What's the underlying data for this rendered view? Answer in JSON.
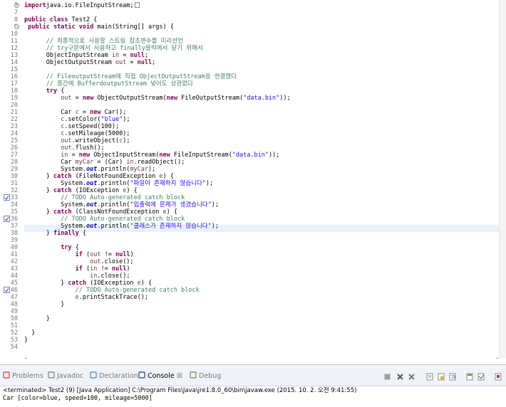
{
  "editor": {
    "lines": [
      {
        "num": "1",
        "segs": [
          [
            "kw",
            "import"
          ],
          [
            "",
            "java.io.FileInputStream;"
          ]
        ],
        "tail": "box"
      },
      {
        "num": "7",
        "segs": []
      },
      {
        "num": "8",
        "segs": [
          [
            "kw",
            "public class"
          ],
          [
            "",
            " Test2 {"
          ]
        ]
      },
      {
        "num": "9",
        "segs": [
          [
            "",
            " "
          ],
          [
            "kw",
            "public static void"
          ],
          [
            "",
            " main(String[] args) {"
          ]
        ]
      },
      {
        "num": "10",
        "segs": []
      },
      {
        "num": "11",
        "segs": [
          [
            "",
            "      "
          ],
          [
            "cm",
            "// 최종적으로 사용할 스트림 참조변수를 미리선언"
          ]
        ]
      },
      {
        "num": "12",
        "segs": [
          [
            "",
            "      "
          ],
          [
            "cm",
            "// try구문에서 사용하고 finally블럭에서 닫기 위해서"
          ]
        ]
      },
      {
        "num": "13",
        "segs": [
          [
            "",
            "      ObjectInputStream "
          ],
          [
            "vr",
            "in"
          ],
          [
            "",
            " = "
          ],
          [
            "kw",
            "null"
          ],
          [
            "",
            ";"
          ]
        ]
      },
      {
        "num": "14",
        "segs": [
          [
            "",
            "      ObjectOutputStream "
          ],
          [
            "vr",
            "out"
          ],
          [
            "",
            " = "
          ],
          [
            "kw",
            "null"
          ],
          [
            "",
            ";"
          ]
        ]
      },
      {
        "num": "15",
        "segs": []
      },
      {
        "num": "16",
        "segs": [
          [
            "",
            "      "
          ],
          [
            "cm",
            "// FileoutputStream에 직접 ObjectOutputStream을 연결했다"
          ]
        ]
      },
      {
        "num": "17",
        "segs": [
          [
            "",
            "      "
          ],
          [
            "cm",
            "// 중간에 BufferdoutputStream 넣어도 상관없다"
          ]
        ]
      },
      {
        "num": "18",
        "segs": [
          [
            "",
            "      "
          ],
          [
            "kw",
            "try"
          ],
          [
            "",
            " {"
          ]
        ]
      },
      {
        "num": "19",
        "segs": [
          [
            "",
            "          "
          ],
          [
            "vr",
            "out"
          ],
          [
            "",
            " = "
          ],
          [
            "kw",
            "new"
          ],
          [
            "",
            " ObjectOutputStream("
          ],
          [
            "kw",
            "new"
          ],
          [
            "",
            " FileOutputStream("
          ],
          [
            "st",
            "\"data.bin\""
          ],
          [
            "",
            "));"
          ]
        ]
      },
      {
        "num": "20",
        "segs": []
      },
      {
        "num": "21",
        "segs": [
          [
            "",
            "          Car "
          ],
          [
            "vr",
            "c"
          ],
          [
            "",
            " = "
          ],
          [
            "kw",
            "new"
          ],
          [
            "",
            " Car();"
          ]
        ]
      },
      {
        "num": "22",
        "segs": [
          [
            "",
            "          "
          ],
          [
            "vr",
            "c"
          ],
          [
            "",
            ".setColor("
          ],
          [
            "st",
            "\"blue\""
          ],
          [
            "",
            ");"
          ]
        ]
      },
      {
        "num": "23",
        "segs": [
          [
            "",
            "          "
          ],
          [
            "vr",
            "c"
          ],
          [
            "",
            ".setSpeed(100);"
          ]
        ]
      },
      {
        "num": "24",
        "segs": [
          [
            "",
            "          "
          ],
          [
            "vr",
            "c"
          ],
          [
            "",
            ".setMileage(5000);"
          ]
        ]
      },
      {
        "num": "25",
        "segs": [
          [
            "",
            "          "
          ],
          [
            "vr",
            "out"
          ],
          [
            "",
            ".writeObject("
          ],
          [
            "vr",
            "c"
          ],
          [
            "",
            ");"
          ]
        ]
      },
      {
        "num": "26",
        "segs": [
          [
            "",
            "          "
          ],
          [
            "vr",
            "out"
          ],
          [
            "",
            ".flush();"
          ]
        ]
      },
      {
        "num": "27",
        "segs": [
          [
            "",
            "          "
          ],
          [
            "vr",
            "in"
          ],
          [
            "",
            " = "
          ],
          [
            "kw",
            "new"
          ],
          [
            "",
            " ObjectInputStream("
          ],
          [
            "kw",
            "new"
          ],
          [
            "",
            " FileInputStream("
          ],
          [
            "st",
            "\"data.bin\""
          ],
          [
            "",
            "));"
          ]
        ]
      },
      {
        "num": "28",
        "segs": [
          [
            "",
            "          Car "
          ],
          [
            "vr",
            "myCar"
          ],
          [
            "",
            " = (Car) "
          ],
          [
            "vr",
            "in"
          ],
          [
            "",
            ".readObject();"
          ]
        ]
      },
      {
        "num": "29",
        "segs": [
          [
            "",
            "          System."
          ],
          [
            "fi",
            "out"
          ],
          [
            "",
            ".println("
          ],
          [
            "vr",
            "myCar"
          ],
          [
            "",
            ");"
          ]
        ]
      },
      {
        "num": "30",
        "segs": [
          [
            "",
            "      } "
          ],
          [
            "kw",
            "catch"
          ],
          [
            "",
            " (FileNotFoundException "
          ],
          [
            "vr",
            "e"
          ],
          [
            "",
            ") {"
          ]
        ]
      },
      {
        "num": "31",
        "segs": [
          [
            "",
            "          System."
          ],
          [
            "fi",
            "out"
          ],
          [
            "",
            ".println("
          ],
          [
            "st",
            "\"파일이 존재하지 않습니다\""
          ],
          [
            "",
            ");"
          ]
        ]
      },
      {
        "num": "32",
        "segs": [
          [
            "",
            "      } "
          ],
          [
            "kw",
            "catch"
          ],
          [
            "",
            " (IOException "
          ],
          [
            "vr",
            "e"
          ],
          [
            "",
            ") {"
          ]
        ]
      },
      {
        "num": "33",
        "segs": [
          [
            "",
            "          "
          ],
          [
            "cm",
            "// TODO Auto-generated catch block"
          ]
        ]
      },
      {
        "num": "34",
        "segs": [
          [
            "",
            "          System."
          ],
          [
            "fi",
            "out"
          ],
          [
            "",
            ".println("
          ],
          [
            "st",
            "\"입출력에 문제가 생겼습니다\""
          ],
          [
            "",
            ");"
          ]
        ]
      },
      {
        "num": "35",
        "segs": [
          [
            "",
            "      } "
          ],
          [
            "kw",
            "catch"
          ],
          [
            "",
            " (ClassNotFoundException "
          ],
          [
            "vr",
            "e"
          ],
          [
            "",
            ") {"
          ]
        ]
      },
      {
        "num": "36",
        "segs": [
          [
            "",
            "          "
          ],
          [
            "cm",
            "// TODO Auto-generated catch block"
          ]
        ]
      },
      {
        "num": "37",
        "segs": [
          [
            "",
            "          System."
          ],
          [
            "fi",
            "out"
          ],
          [
            "",
            ".println("
          ],
          [
            "st",
            "\"클래스가 존재하지 않습니다\""
          ],
          [
            "",
            ");"
          ]
        ]
      },
      {
        "num": "38",
        "segs": [
          [
            "",
            "      } "
          ],
          [
            "kw",
            "finally"
          ],
          [
            "",
            " {"
          ]
        ]
      },
      {
        "num": "39",
        "segs": []
      },
      {
        "num": "40",
        "segs": [
          [
            "",
            "          "
          ],
          [
            "kw",
            "try"
          ],
          [
            "",
            " {"
          ]
        ]
      },
      {
        "num": "41",
        "segs": [
          [
            "",
            "              "
          ],
          [
            "kw",
            "if"
          ],
          [
            "",
            " ("
          ],
          [
            "vr",
            "out"
          ],
          [
            "",
            " != "
          ],
          [
            "kw",
            "null"
          ],
          [
            "",
            ")"
          ]
        ]
      },
      {
        "num": "42",
        "segs": [
          [
            "",
            "                  "
          ],
          [
            "vr",
            "out"
          ],
          [
            "",
            ".close();"
          ]
        ]
      },
      {
        "num": "43",
        "segs": [
          [
            "",
            "              "
          ],
          [
            "kw",
            "if"
          ],
          [
            "",
            " ("
          ],
          [
            "vr",
            "in"
          ],
          [
            "",
            " != "
          ],
          [
            "kw",
            "null"
          ],
          [
            "",
            ")"
          ]
        ]
      },
      {
        "num": "44",
        "segs": [
          [
            "",
            "                  "
          ],
          [
            "vr",
            "in"
          ],
          [
            "",
            ".close();"
          ]
        ]
      },
      {
        "num": "45",
        "segs": [
          [
            "",
            "          } "
          ],
          [
            "kw",
            "catch"
          ],
          [
            "",
            " (IOException "
          ],
          [
            "vr",
            "e"
          ],
          [
            "",
            ") {"
          ]
        ]
      },
      {
        "num": "46",
        "segs": [
          [
            "",
            "              "
          ],
          [
            "cm",
            "// TODO Auto-generated catch block"
          ]
        ]
      },
      {
        "num": "47",
        "segs": [
          [
            "",
            "              "
          ],
          [
            "vr",
            "e"
          ],
          [
            "",
            ".printStackTrace();"
          ]
        ]
      },
      {
        "num": "48",
        "segs": [
          [
            "",
            "          }"
          ]
        ]
      },
      {
        "num": "49",
        "segs": []
      },
      {
        "num": "50",
        "segs": [
          [
            "",
            "      }"
          ]
        ]
      },
      {
        "num": "51",
        "segs": []
      },
      {
        "num": "52",
        "segs": [
          [
            "",
            "  }"
          ]
        ]
      },
      {
        "num": "53",
        "segs": [
          [
            "",
            "}"
          ]
        ]
      },
      {
        "num": "54",
        "segs": []
      }
    ]
  },
  "console_view": {
    "tabs": [
      {
        "label": "Problems",
        "name": "tab-problems",
        "icon": "problems-icon",
        "color": "#d9534f"
      },
      {
        "label": "Javadoc",
        "name": "tab-javadoc",
        "icon": "at-icon",
        "color": "#8a8a8a"
      },
      {
        "label": "Declaration",
        "name": "tab-declaration",
        "icon": "declaration-icon",
        "color": "#6b8fc7"
      },
      {
        "label": "Console",
        "name": "tab-console",
        "icon": "console-icon",
        "color": "#3a5d8f",
        "close": "☒"
      },
      {
        "label": "Debug",
        "name": "tab-debug",
        "icon": "debug-icon",
        "color": "#7a9a5a"
      }
    ],
    "status": "<terminated> Test2 (9) [Java Application] C:\\Program Files\\Java\\jre1.8.0_60\\bin\\javaw.exe (2015. 10. 2. 오전 9:41:55)",
    "output": "Car [color=blue, speed=100, mileage=5000]"
  }
}
